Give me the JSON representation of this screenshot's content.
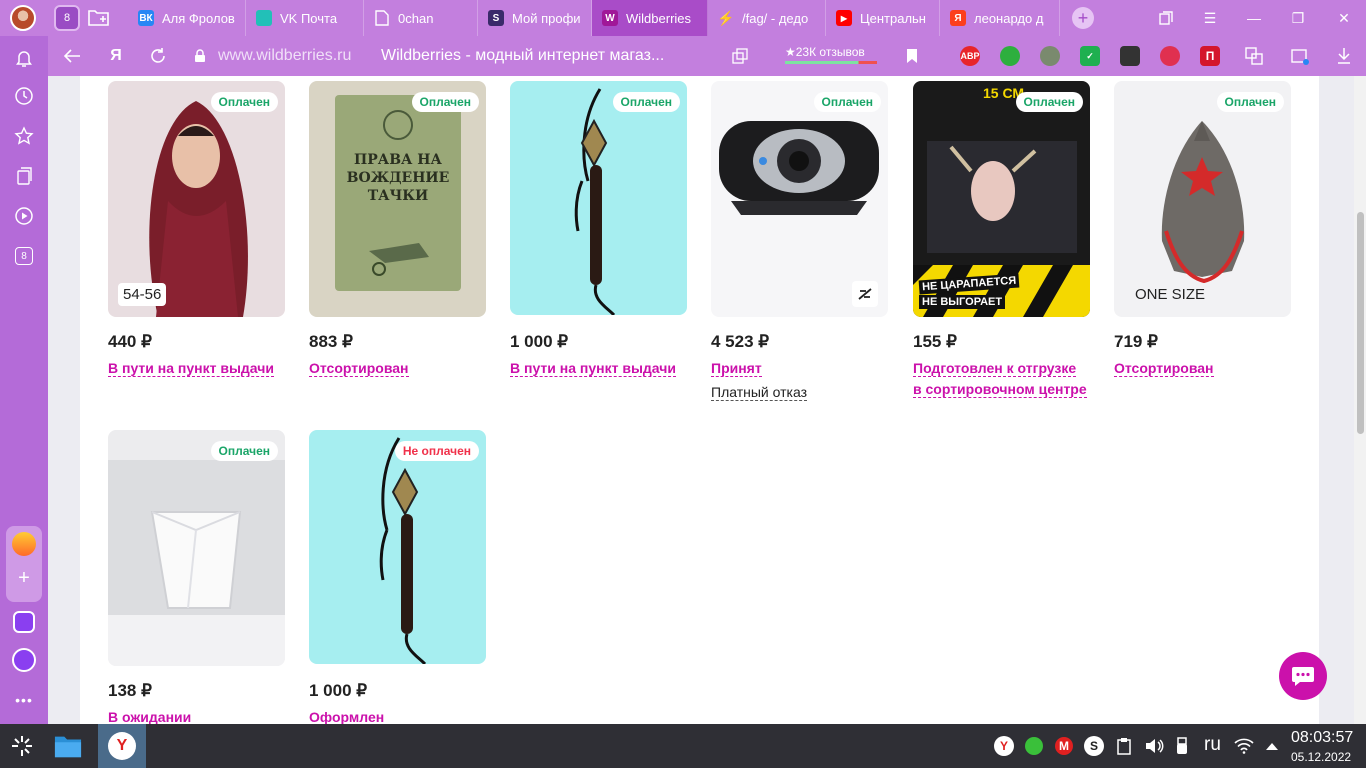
{
  "tabs": {
    "counter": "8",
    "items": [
      {
        "label": "Аля Фролов",
        "fav": "ВК",
        "color": "#2787f5"
      },
      {
        "label": "VK Почта",
        "fav": "",
        "color": "#22c0b8"
      },
      {
        "label": "0chan",
        "fav": "",
        "color": "transparent"
      },
      {
        "label": "Мой профи",
        "fav": "S",
        "color": "#3a2a6a"
      },
      {
        "label": "Wildberries",
        "fav": "W",
        "color": "#a01898"
      },
      {
        "label": "/fag/ - дедо",
        "fav": "⚡",
        "color": "transparent"
      },
      {
        "label": "Центральн",
        "fav": "▶",
        "color": "#ff0000"
      },
      {
        "label": "леонардо д",
        "fav": "Я",
        "color": "#fc3f1d"
      }
    ]
  },
  "address": {
    "url": "www.wildberries.ru",
    "title": "Wildberries - модный интернет магаз...",
    "reviews": "★23К отзывов"
  },
  "extensions": [
    "ABP"
  ],
  "sidebar": {
    "counter": "8"
  },
  "products": [
    {
      "badge": "Оплачен",
      "size": "54-56",
      "price": "440 ₽",
      "status": "В пути на пункт выдачи",
      "bg": "#e8dde0"
    },
    {
      "badge": "Оплачен",
      "size": "",
      "price": "883 ₽",
      "status": "Отсортирован",
      "bg": "#d9d4c4",
      "img_text": "ПРАВА НА ВОЖДЕНИЕ ТАЧКИ"
    },
    {
      "badge": "Оплачен",
      "size": "",
      "price": "1 000 ₽",
      "status": "В пути на пункт выдачи",
      "bg": "#a6eef0"
    },
    {
      "badge": "Оплачен",
      "size": "",
      "price": "4 523 ₽",
      "status": "Принят",
      "refusal": "Платный отказ",
      "bg": "#f6f6f8"
    },
    {
      "badge": "Оплачен",
      "size": "",
      "price": "155 ₽",
      "status": "Подготовлен к отгрузке в сортировочном центре",
      "bg": "#1a1a1a",
      "img_text_top": "15 СМ",
      "img_text_bottom1": "НЕ ЦАРАПАЕТСЯ",
      "img_text_bottom2": "НЕ ВЫГОРАЕТ"
    },
    {
      "badge": "Оплачен",
      "size": "ONE SIZE",
      "price": "719 ₽",
      "status": "Отсортирован",
      "bg": "#f2f2f4"
    },
    {
      "badge": "Оплачен",
      "size": "",
      "price": "138 ₽",
      "status": "В ожидании",
      "bg": "#ececee"
    },
    {
      "badge": "Не оплачен",
      "size": "",
      "price": "1 000 ₽",
      "status": "Оформлен",
      "bg": "#a6eef0"
    }
  ],
  "taskbar": {
    "lang": "ru",
    "time": "08:03:57",
    "date": "05.12.2022"
  }
}
